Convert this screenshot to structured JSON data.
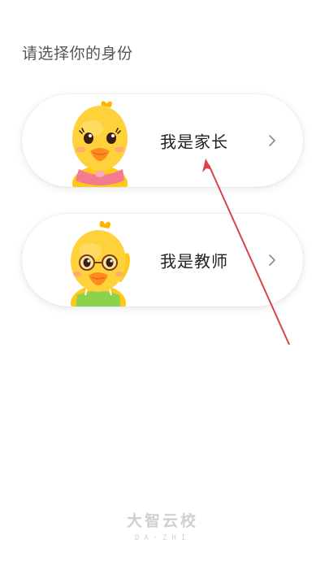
{
  "page": {
    "prompt": "请选择你的身份"
  },
  "roles": [
    {
      "label": "我是家长",
      "mascot": "duck-with-eyelashes-pink-collar-icon"
    },
    {
      "label": "我是教师",
      "mascot": "duck-with-glasses-green-apron-icon"
    }
  ],
  "brand": {
    "name": "大智云校",
    "sub": "DA·ZHI"
  },
  "colors": {
    "annotation_arrow": "#d9444a",
    "duck_yellow": "#ffc91a",
    "beak_orange": "#ff8a1e",
    "collar_pink": "#f27b8f",
    "apron_green": "#8cd24a"
  }
}
